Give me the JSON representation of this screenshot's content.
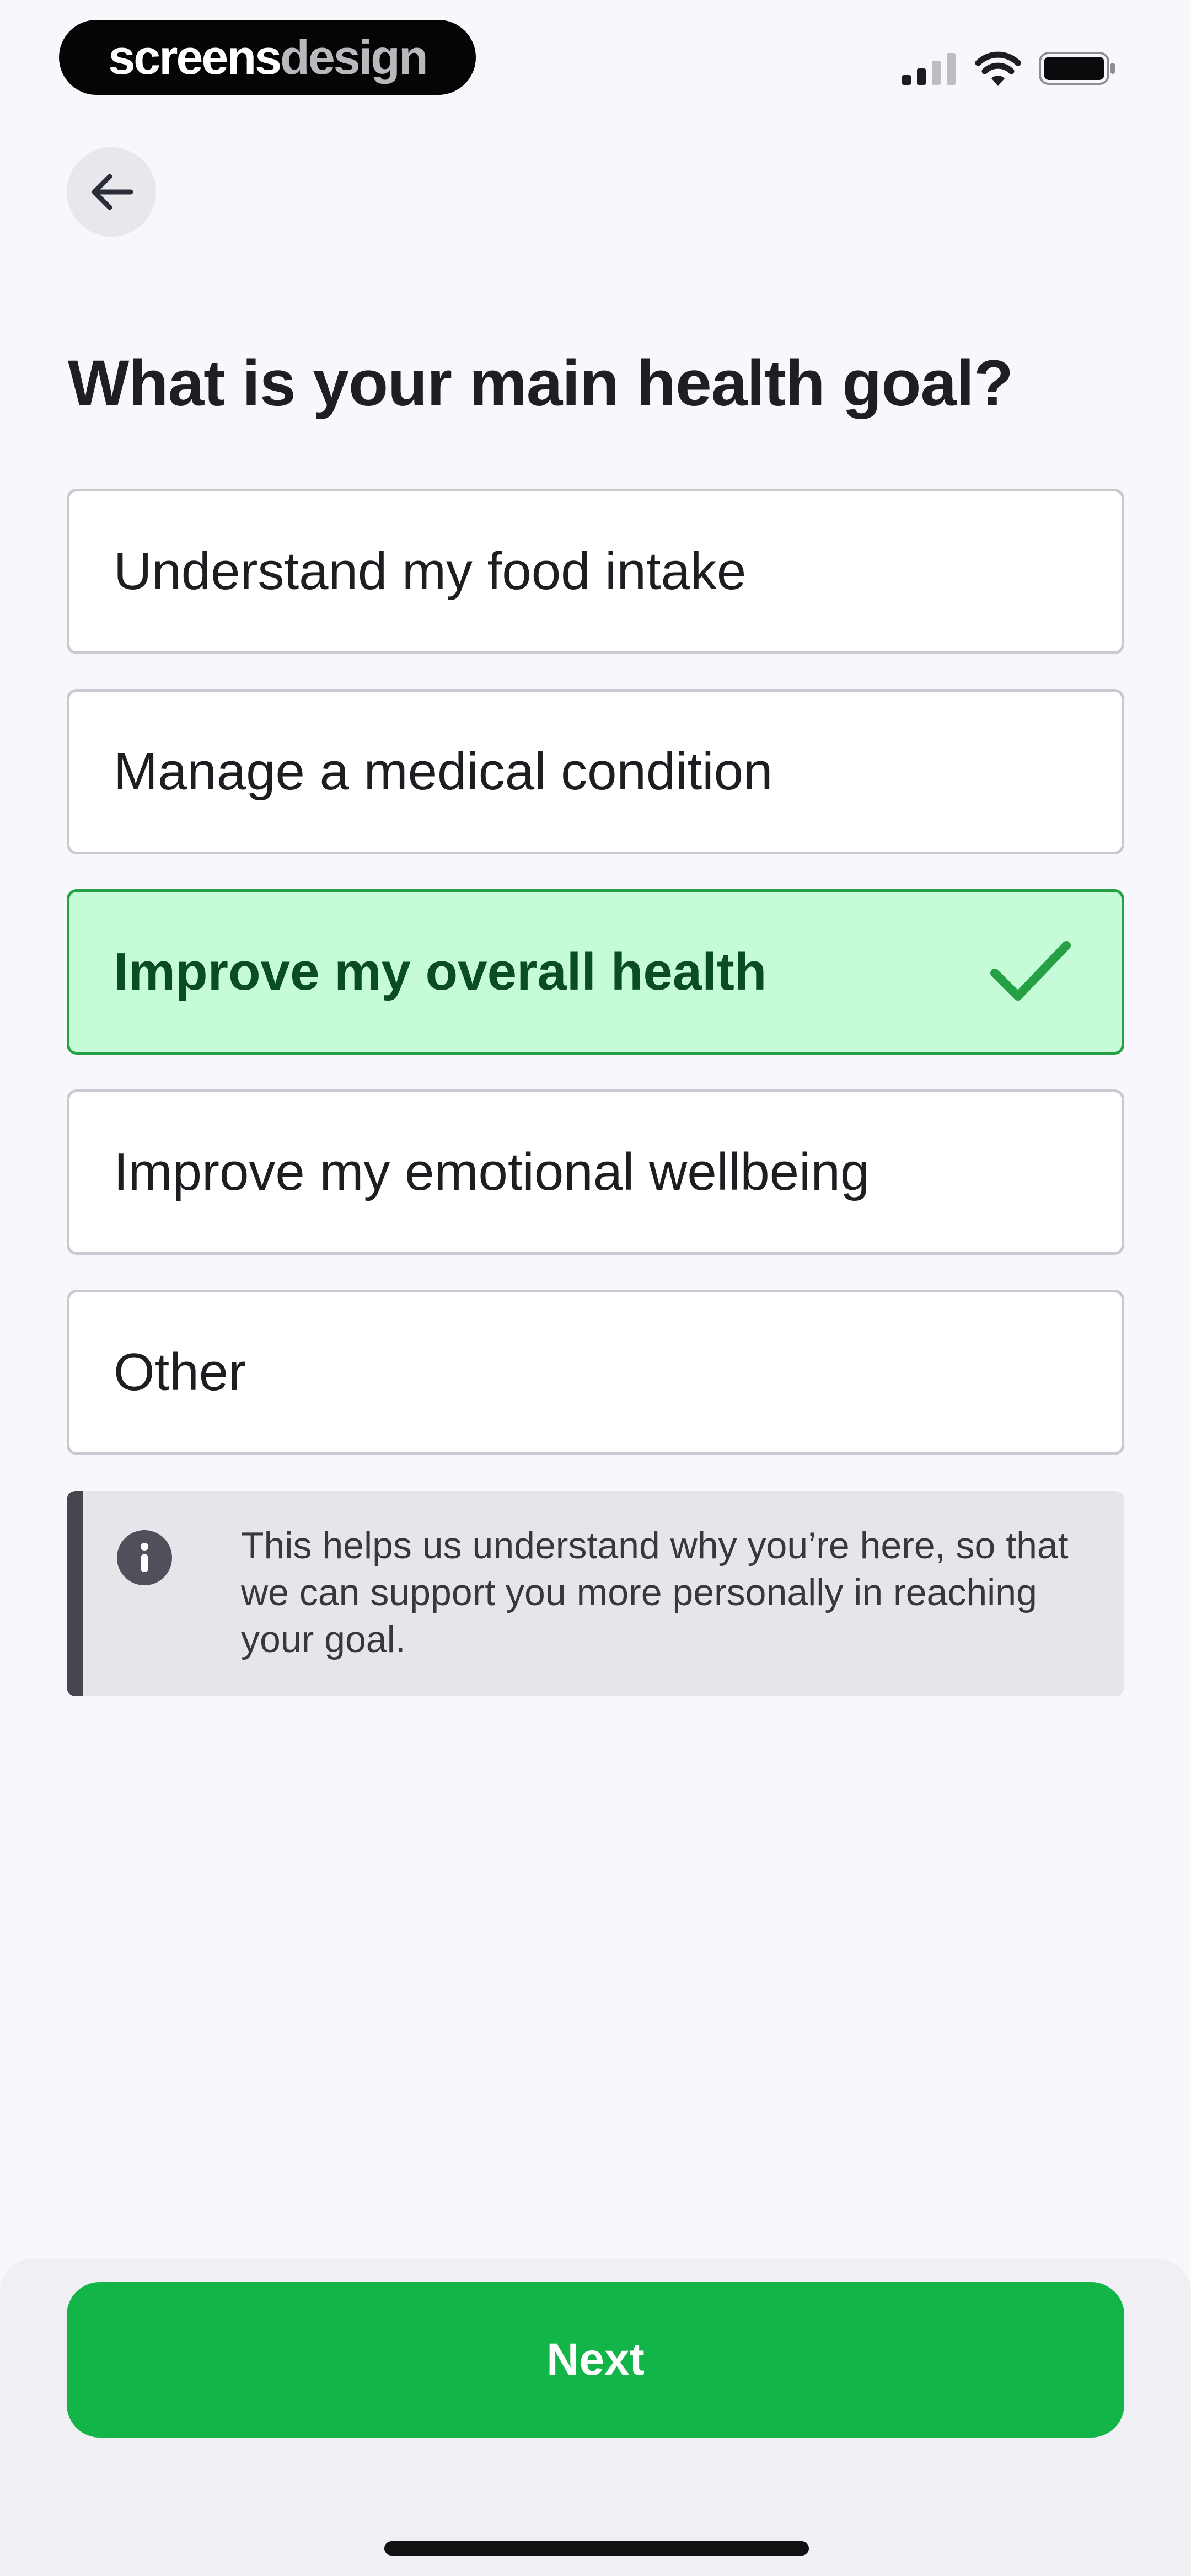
{
  "status_bar": {
    "brand_part1": "screens",
    "brand_part2": "design",
    "icons": [
      "signal-icon",
      "wifi-icon",
      "battery-icon"
    ]
  },
  "nav": {
    "back_icon": "arrow-left-icon"
  },
  "question": {
    "title": "What is your main health goal?"
  },
  "options": [
    {
      "label": "Understand my food intake",
      "selected": false
    },
    {
      "label": "Manage a medical condition",
      "selected": false
    },
    {
      "label": "Improve my overall health",
      "selected": true,
      "icon": "checkmark-icon"
    },
    {
      "label": "Improve my emotional wellbeing",
      "selected": false
    },
    {
      "label": "Other",
      "selected": false
    }
  ],
  "info": {
    "icon": "info-icon",
    "text": "This helps us understand why you’re here, so that we can support you more personally in reaching your goal."
  },
  "footer": {
    "next_label": "Next"
  },
  "colors": {
    "accent": "#13b548",
    "selected_bg": "#c6fbd7",
    "selected_border": "#25a044",
    "selected_text": "#0b4d22",
    "background": "#f8f8fc"
  }
}
